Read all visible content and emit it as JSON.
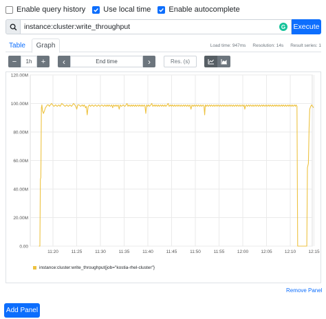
{
  "options": [
    {
      "label": "Enable query history",
      "checked": false
    },
    {
      "label": "Use local time",
      "checked": true
    },
    {
      "label": "Enable autocomplete",
      "checked": true
    }
  ],
  "query": {
    "value": "instance:cluster:write_throughput",
    "execute_label": "Execute",
    "grammarly_badge": "G"
  },
  "tabs": [
    {
      "label": "Table",
      "active": false
    },
    {
      "label": "Graph",
      "active": true
    }
  ],
  "stats": {
    "load_time": "Load time: 947ms",
    "resolution": "Resolution: 14s",
    "result_series": "Result series: 1"
  },
  "controls": {
    "minus": "−",
    "range": "1h",
    "plus": "+",
    "prev": "‹",
    "end_time": "End time",
    "next": "›",
    "res_placeholder": "Res. (s)"
  },
  "icons": {
    "search": "search-icon",
    "line_chart": "line-chart-icon",
    "stacked_chart": "stacked-chart-icon"
  },
  "colors": {
    "accent": "#0d6efd",
    "series": "#edc240",
    "button_grey": "#6c757d"
  },
  "chart_data": {
    "type": "line",
    "yticks": [
      "0.00",
      "20.00M",
      "40.00M",
      "60.00M",
      "80.00M",
      "100.00M",
      "120.00M"
    ],
    "xticks": [
      "11:20",
      "11:25",
      "11:30",
      "11:35",
      "11:40",
      "11:45",
      "11:50",
      "11:55",
      "12:00",
      "12:05",
      "12:10",
      "12:15"
    ],
    "ylim": [
      0,
      120
    ],
    "y_unit": "M",
    "xlim_minutes": [
      -5.7,
      16.1
    ],
    "grid": true,
    "legend_placement": "bottom-left",
    "series": [
      {
        "name": "instance:cluster:write_throughput{job=\"kostia-rhel-cluster\"}",
        "color": "#edc240",
        "points": [
          [
            -4.3,
            0
          ],
          [
            -4.0,
            0
          ],
          [
            -3.85,
            47
          ],
          [
            -3.7,
            48
          ],
          [
            -3.55,
            97
          ],
          [
            -3.4,
            99
          ],
          [
            -3.2,
            95
          ],
          [
            -2.9,
            93
          ],
          [
            -2.6,
            95
          ],
          [
            -2.3,
            97
          ],
          [
            -2.0,
            98
          ],
          [
            -1.7,
            99
          ],
          [
            -1.4,
            99
          ],
          [
            -1.1,
            98
          ],
          [
            -0.8,
            99
          ],
          [
            -0.4,
            100
          ],
          [
            -0.1,
            99
          ],
          [
            0.3,
            98
          ],
          [
            0.8,
            99
          ],
          [
            1.3,
            98
          ],
          [
            1.8,
            99
          ],
          [
            2.2,
            98
          ],
          [
            2.7,
            100
          ],
          [
            3.2,
            99
          ],
          [
            3.7,
            98
          ],
          [
            4.2,
            99
          ],
          [
            4.7,
            98
          ],
          [
            5.2,
            99
          ],
          [
            5.7,
            98
          ],
          [
            6.0,
            99
          ],
          [
            6.3,
            100
          ],
          [
            6.7,
            99
          ],
          [
            7.0,
            98
          ],
          [
            7.3,
            96
          ],
          [
            7.6,
            99
          ],
          [
            8.0,
            99
          ],
          [
            8.5,
            98
          ],
          [
            9.0,
            99
          ],
          [
            9.3,
            98
          ],
          [
            9.6,
            99
          ],
          [
            9.8,
            98
          ],
          [
            10.0,
            97
          ],
          [
            10.2,
            98
          ],
          [
            10.5,
            92
          ],
          [
            10.8,
            98
          ],
          [
            11.2,
            99
          ],
          [
            11.5,
            98
          ],
          [
            12.0,
            99
          ],
          [
            12.5,
            98
          ],
          [
            13.0,
            99
          ],
          [
            13.5,
            98
          ],
          [
            14.0,
            99
          ],
          [
            14.4,
            98
          ],
          [
            15.0,
            99
          ],
          [
            15.5,
            98
          ],
          [
            15.9,
            99
          ],
          [
            16.3,
            98
          ],
          [
            16.6,
            99
          ],
          [
            16.9,
            98
          ],
          [
            17.2,
            99
          ],
          [
            17.6,
            98
          ],
          [
            18.0,
            99
          ],
          [
            18.3,
            97
          ],
          [
            18.6,
            99
          ],
          [
            19.0,
            98
          ],
          [
            19.3,
            99
          ],
          [
            19.6,
            98
          ],
          [
            20.0,
            99
          ],
          [
            20.3,
            96
          ],
          [
            20.6,
            99
          ],
          [
            21.0,
            98
          ],
          [
            21.5,
            99
          ],
          [
            22.0,
            98
          ],
          [
            22.4,
            99
          ],
          [
            22.7,
            100
          ],
          [
            23.0,
            98
          ],
          [
            23.3,
            99
          ],
          [
            23.7,
            98
          ],
          [
            24.0,
            99
          ],
          [
            24.3,
            98
          ],
          [
            24.6,
            99
          ],
          [
            25.0,
            98
          ],
          [
            25.3,
            99
          ],
          [
            25.6,
            98
          ],
          [
            26.0,
            99
          ],
          [
            26.3,
            98
          ],
          [
            26.6,
            99
          ],
          [
            27.0,
            98
          ],
          [
            27.3,
            99
          ],
          [
            27.6,
            98
          ],
          [
            28.0,
            99
          ],
          [
            28.2,
            98
          ],
          [
            28.45,
            93
          ],
          [
            28.7,
            99
          ],
          [
            29.0,
            98
          ],
          [
            29.3,
            99
          ],
          [
            29.6,
            98
          ],
          [
            30.0,
            99
          ],
          [
            30.3,
            100
          ],
          [
            30.6,
            98
          ],
          [
            31.0,
            99
          ],
          [
            31.3,
            98
          ],
          [
            31.6,
            99
          ],
          [
            32.0,
            98
          ],
          [
            32.3,
            99
          ],
          [
            32.6,
            98
          ],
          [
            33.0,
            99
          ],
          [
            33.3,
            98
          ],
          [
            33.6,
            99
          ],
          [
            34.0,
            98
          ],
          [
            34.3,
            99
          ],
          [
            34.6,
            98
          ],
          [
            35.0,
            99
          ],
          [
            35.3,
            100
          ],
          [
            35.6,
            98
          ],
          [
            36.0,
            99
          ],
          [
            36.3,
            98
          ],
          [
            36.6,
            99
          ],
          [
            37.0,
            98
          ],
          [
            37.3,
            99
          ],
          [
            37.6,
            98
          ],
          [
            38.0,
            99
          ],
          [
            38.3,
            98
          ],
          [
            38.6,
            99
          ],
          [
            39.0,
            98
          ],
          [
            39.3,
            99
          ],
          [
            39.6,
            98
          ],
          [
            40.0,
            99
          ],
          [
            40.3,
            98
          ],
          [
            40.6,
            99
          ],
          [
            41.0,
            98
          ],
          [
            41.3,
            99
          ],
          [
            41.6,
            98
          ],
          [
            42.0,
            99
          ],
          [
            42.3,
            96
          ],
          [
            42.6,
            99
          ],
          [
            43.0,
            98
          ],
          [
            43.3,
            99
          ],
          [
            43.6,
            98
          ],
          [
            44.0,
            99
          ],
          [
            44.3,
            98
          ],
          [
            44.6,
            99
          ],
          [
            45.0,
            98
          ],
          [
            45.3,
            99
          ],
          [
            45.6,
            98
          ],
          [
            46.0,
            99
          ],
          [
            46.3,
            98
          ],
          [
            46.5,
            92
          ],
          [
            46.7,
            99
          ],
          [
            47.0,
            98
          ],
          [
            47.3,
            99
          ],
          [
            47.6,
            98
          ],
          [
            48.0,
            99
          ],
          [
            48.3,
            98
          ],
          [
            48.6,
            99
          ],
          [
            49.0,
            98
          ],
          [
            49.3,
            99
          ],
          [
            49.6,
            98
          ],
          [
            50.0,
            99
          ],
          [
            50.3,
            98
          ],
          [
            50.6,
            99
          ],
          [
            51.0,
            98
          ],
          [
            51.3,
            99
          ],
          [
            51.6,
            98
          ],
          [
            52.0,
            99
          ],
          [
            52.3,
            98
          ],
          [
            52.6,
            99
          ],
          [
            53.0,
            98
          ],
          [
            53.3,
            99
          ],
          [
            53.6,
            98
          ],
          [
            54.0,
            99
          ],
          [
            54.3,
            98
          ],
          [
            54.6,
            99
          ],
          [
            55.0,
            98
          ],
          [
            55.3,
            99
          ],
          [
            55.6,
            98
          ],
          [
            56.0,
            99
          ],
          [
            56.3,
            98
          ],
          [
            56.6,
            99
          ],
          [
            57.0,
            98
          ],
          [
            57.3,
            99
          ],
          [
            57.6,
            98
          ],
          [
            58.0,
            99
          ],
          [
            58.3,
            98
          ],
          [
            58.6,
            99
          ],
          [
            58.8,
            96
          ],
          [
            59.0,
            98
          ],
          [
            59.3,
            99
          ],
          [
            59.6,
            98
          ],
          [
            60.0,
            99
          ],
          [
            60.3,
            98
          ],
          [
            60.6,
            99
          ],
          [
            61.0,
            98
          ],
          [
            61.3,
            99
          ],
          [
            61.6,
            98
          ],
          [
            62.0,
            99
          ],
          [
            62.3,
            98
          ],
          [
            62.6,
            99
          ],
          [
            63.0,
            98
          ],
          [
            63.3,
            99
          ],
          [
            63.6,
            98
          ],
          [
            64.0,
            99
          ],
          [
            64.3,
            98
          ],
          [
            64.6,
            99
          ],
          [
            65.0,
            98
          ],
          [
            65.3,
            99
          ],
          [
            65.6,
            98
          ],
          [
            66.0,
            99
          ],
          [
            66.3,
            98
          ],
          [
            66.6,
            99
          ],
          [
            67.0,
            98
          ],
          [
            67.3,
            99
          ],
          [
            67.6,
            98
          ],
          [
            68.0,
            99
          ],
          [
            68.3,
            98
          ],
          [
            68.6,
            99
          ],
          [
            69.0,
            98
          ],
          [
            69.3,
            99
          ],
          [
            69.6,
            98
          ],
          [
            70.0,
            99
          ],
          [
            70.3,
            98
          ],
          [
            70.6,
            99
          ],
          [
            71.0,
            98
          ],
          [
            71.3,
            99
          ],
          [
            71.6,
            98
          ],
          [
            72.0,
            99
          ],
          [
            72.3,
            98
          ],
          [
            72.6,
            99
          ],
          [
            73.0,
            98
          ],
          [
            73.3,
            99
          ],
          [
            73.6,
            98
          ],
          [
            74.0,
            99
          ],
          [
            74.3,
            98
          ],
          [
            74.5,
            99
          ],
          [
            74.8,
            98
          ],
          [
            75.0,
            0
          ],
          [
            76.5,
            0
          ],
          [
            77.0,
            0
          ],
          [
            77.6,
            0
          ],
          [
            77.8,
            0
          ],
          [
            78.0,
            55
          ],
          [
            78.3,
            58
          ],
          [
            78.5,
            82
          ],
          [
            78.7,
            96
          ],
          [
            79.0,
            98
          ],
          [
            79.3,
            99
          ],
          [
            79.6,
            98
          ],
          [
            79.9,
            97
          ]
        ]
      }
    ]
  }
}
